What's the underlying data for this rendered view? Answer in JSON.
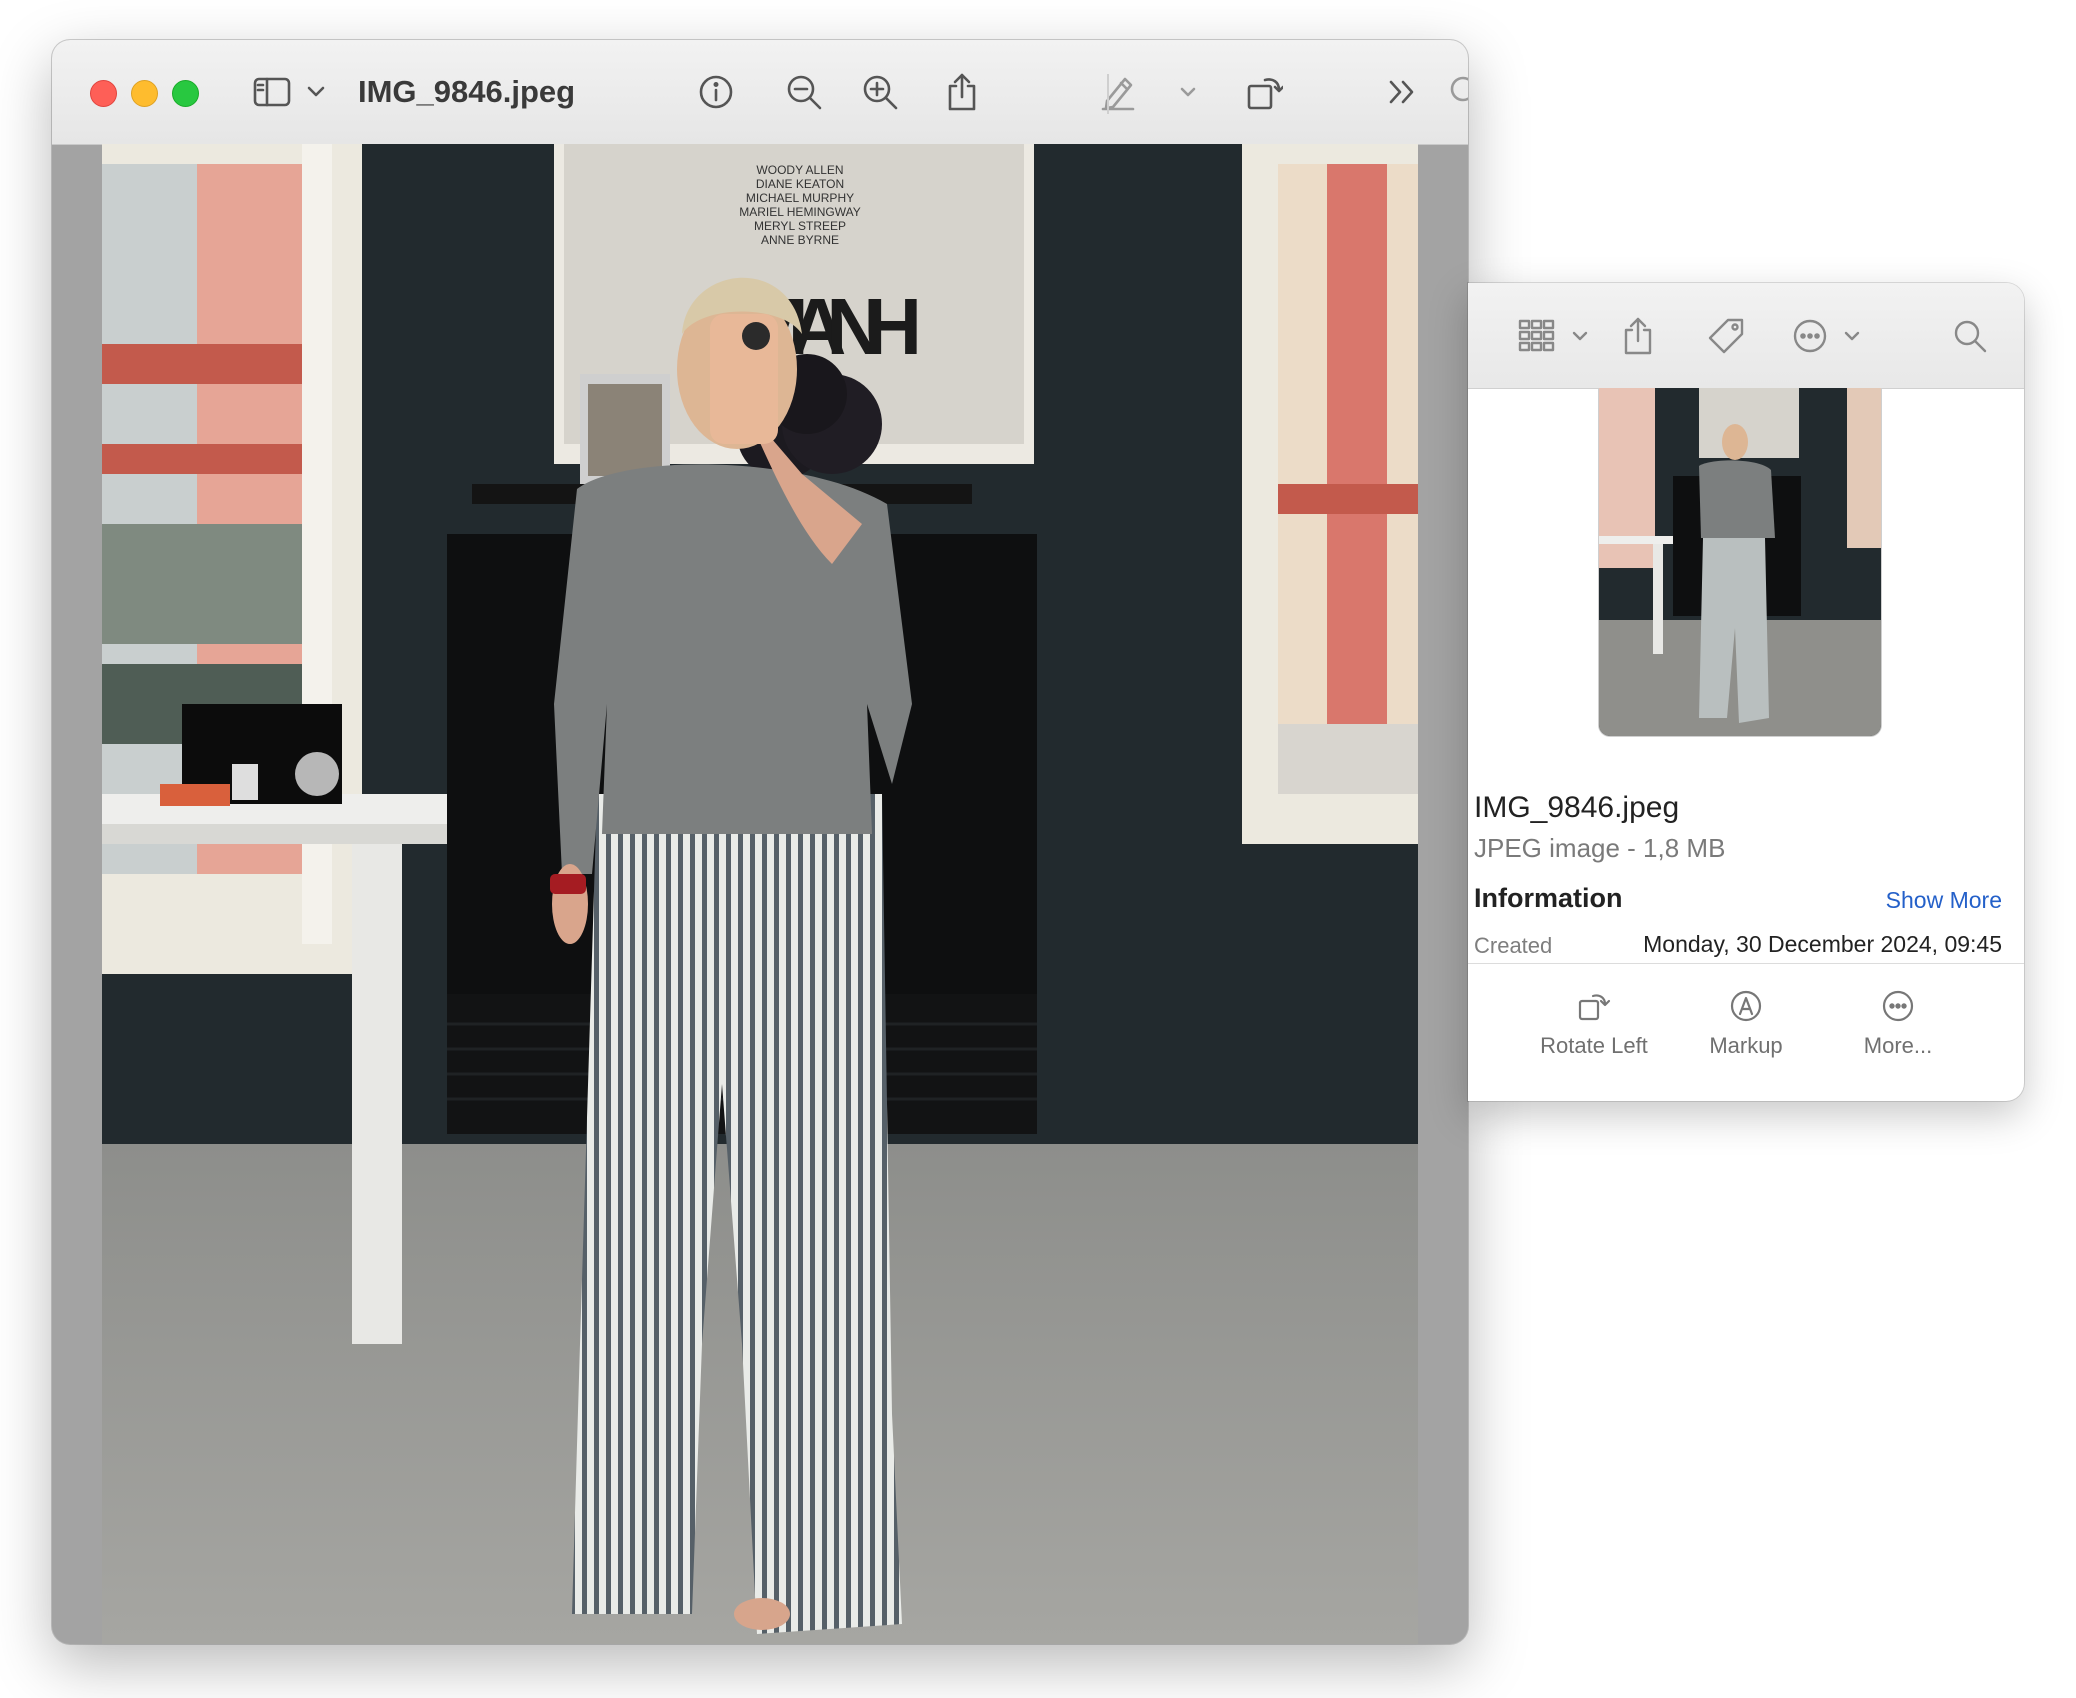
{
  "window": {
    "title": "IMG_9846.jpeg",
    "icons": [
      "sidebar-icon",
      "chevron-down-icon",
      "info-icon",
      "zoom-out-icon",
      "zoom-in-icon",
      "share-icon",
      "markup-pen-icon",
      "chevron-down-icon",
      "rotate-icon",
      "more-chevrons-icon",
      "search-icon"
    ]
  },
  "poster": {
    "credits": [
      "WOODY ALLEN",
      "DIANE KEATON",
      "MICHAEL MURPHY",
      "MARIEL HEMINGWAY",
      "MERYL STREEP",
      "ANNE BYRNE"
    ],
    "headline": "MANH"
  },
  "info_panel": {
    "icons": [
      "gallery-icon",
      "chevron-down-icon",
      "share-icon",
      "tag-icon",
      "ellipsis-circle-icon",
      "chevron-down-icon",
      "search-icon"
    ],
    "filename": "IMG_9846.jpeg",
    "kind": "JPEG image - 1,8 MB",
    "section_title": "Information",
    "show_more": "Show More",
    "created_label": "Created",
    "created_value": "Monday, 30 December 2024, 09:45",
    "actions": [
      {
        "label": "Rotate Left",
        "icon": "rotate-left-icon"
      },
      {
        "label": "Markup",
        "icon": "markup-icon"
      },
      {
        "label": "More...",
        "icon": "ellipsis-circle-icon"
      }
    ]
  },
  "colors": {
    "close": "#fe5f57",
    "minimize": "#febc2e",
    "zoom": "#28c840",
    "link": "#2460c9"
  }
}
